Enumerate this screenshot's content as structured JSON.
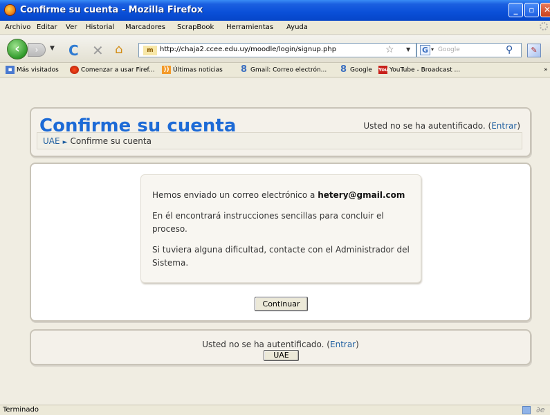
{
  "window": {
    "title": "Confirme su cuenta - Mozilla Firefox",
    "min_symbol": "_",
    "max_symbol": "▫",
    "close_symbol": "✕"
  },
  "menu": {
    "items": [
      "Archivo",
      "Editar",
      "Ver",
      "Historial",
      "Marcadores",
      "ScrapBook",
      "Herramientas",
      "Ayuda"
    ]
  },
  "nav": {
    "url": "http://chaja2.ccee.edu.uy/moodle/login/signup.php",
    "search_placeholder": "Google",
    "site_icon_text": "m"
  },
  "bookmarks": {
    "items": [
      "Más visitados",
      "Comenzar a usar Firef...",
      "Últimas noticias",
      "Gmail: Correo electrón...",
      "Google",
      "YouTube - Broadcast ..."
    ],
    "overflow": "»"
  },
  "page": {
    "title": "Confirme su cuenta",
    "login_text": "Usted no se ha autentificado. (",
    "login_link": "Entrar",
    "login_close": ")",
    "breadcrumb": {
      "home": "UAE",
      "current": "Confirme su cuenta"
    },
    "message": {
      "p1_text": "Hemos enviado un correo electrónico a ",
      "email": "hetery@gmail.com",
      "p2": "En él encontrará instrucciones sencillas para concluir el proceso.",
      "p3": "Si tuviera alguna dificultad, contacte con el Administrador del Sistema."
    },
    "continue_button": "Continuar",
    "footer": {
      "login_text": "Usted no se ha autentificado. (",
      "login_link": "Entrar",
      "login_close": ")",
      "home_button": "UAE"
    }
  },
  "status": {
    "text": "Terminado"
  }
}
